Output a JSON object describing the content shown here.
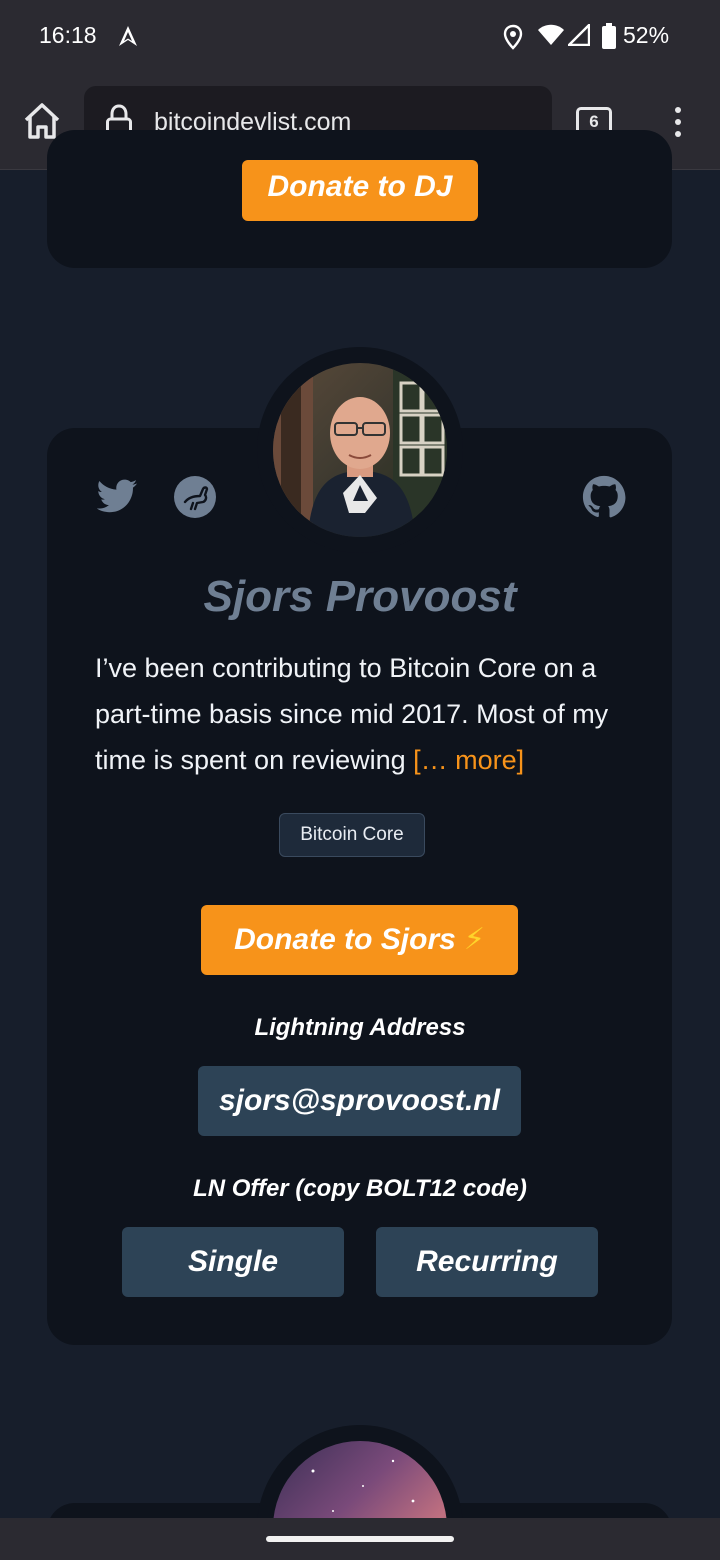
{
  "status_bar": {
    "time": "16:18",
    "battery": "52%",
    "icons": [
      "navigation-arrow-icon",
      "location-pin-icon",
      "wifi-icon",
      "signal-icon",
      "battery-icon"
    ]
  },
  "browser": {
    "url": "bitcoindevlist.com",
    "tab_count": "6"
  },
  "previous_card": {
    "donate_label": "Donate to DJ"
  },
  "profile": {
    "name": "Sjors Provoost",
    "bio": "I’ve been contributing to Bitcoin Core on a part-time basis since mid 2017. Most of my time is spent on reviewing ",
    "more_link": "[… more]",
    "tag": "Bitcoin Core",
    "socials": [
      "twitter-icon",
      "nostr-icon",
      "github-icon"
    ],
    "donate_label": "Donate to Sjors",
    "donate_icon": "⚡",
    "lightning_address_label": "Lightning Address",
    "lightning_address": "sjors@sprovoost.nl",
    "ln_offer_label": "LN Offer (copy BOLT12 code)",
    "offer_buttons": [
      "Single",
      "Recurring"
    ]
  },
  "colors": {
    "background": "#171e2b",
    "card": "#0e131c",
    "accent": "#f7931a",
    "slate_button": "#2d4356",
    "name_text": "#6f7f93"
  }
}
